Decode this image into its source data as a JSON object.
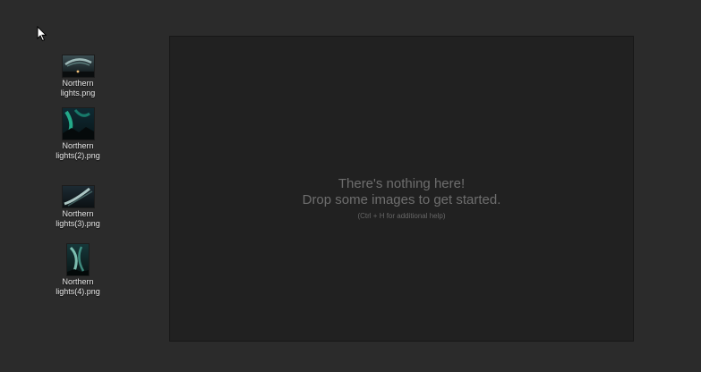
{
  "desktop": {
    "icons": [
      {
        "label": "Northern\nlights.png",
        "icon": "image-thumbnail-icon"
      },
      {
        "label": "Northern\nlights(2).png",
        "icon": "image-thumbnail-icon"
      },
      {
        "label": "Northern\nlights(3).png",
        "icon": "image-thumbnail-icon"
      },
      {
        "label": "Northern\nlights(4).png",
        "icon": "image-thumbnail-icon"
      }
    ]
  },
  "viewer": {
    "empty_line1": "There's nothing here!",
    "empty_line2": "Drop some images to get started.",
    "empty_hint": "(Ctrl + H for additional help)"
  },
  "colors": {
    "desktop_bg": "#2b2b2b",
    "viewer_bg": "#212121",
    "message_text": "#6e6e6e"
  }
}
